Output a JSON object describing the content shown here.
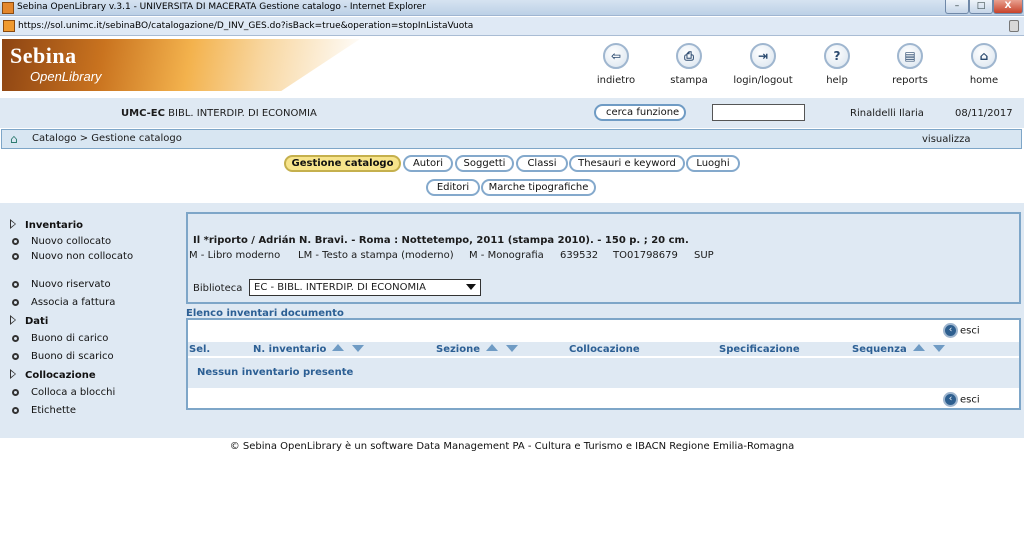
{
  "window": {
    "title": "Sebina OpenLibrary v.3.1 - UNIVERSITA DI MACERATA Gestione catalogo - Internet Explorer",
    "url": "https://sol.unimc.it/sebinaBO/catalogazione/D_INV_GES.do?isBack=true&operation=stopInListaVuota",
    "controls": {
      "minimize": "–",
      "maximize": "□",
      "close": "X"
    }
  },
  "logo": {
    "line1": "Sebina",
    "line2": "OpenLibrary"
  },
  "toolbar": [
    {
      "label": "indietro",
      "icon": "back-arrow-icon",
      "glyph": "⇦"
    },
    {
      "label": "stampa",
      "icon": "printer-icon",
      "glyph": "⎙"
    },
    {
      "label": "login/logout",
      "icon": "door-icon",
      "glyph": "⇥"
    },
    {
      "label": "help",
      "icon": "question-icon",
      "glyph": "?"
    },
    {
      "label": "reports",
      "icon": "documents-icon",
      "glyph": "▤"
    },
    {
      "label": "home",
      "icon": "home-icon",
      "glyph": "⌂"
    }
  ],
  "info": {
    "library_code": "UMC-EC",
    "library_name": "BIBL. INTERDIP. DI ECONOMIA",
    "cerca_label": "cerca funzione",
    "cerca_value": "",
    "user": "Rinaldelli Ilaria",
    "date": "08/11/2017"
  },
  "breadcrumb": {
    "path": "Catalogo > Gestione catalogo",
    "view_label": "visualizza"
  },
  "tabs": {
    "row1": [
      {
        "label": "Gestione catalogo",
        "active": true
      },
      {
        "label": "Autori",
        "active": false
      },
      {
        "label": "Soggetti",
        "active": false
      },
      {
        "label": "Classi",
        "active": false
      },
      {
        "label": "Thesauri e keyword",
        "active": false
      },
      {
        "label": "Luoghi",
        "active": false
      }
    ],
    "row2": [
      {
        "label": "Editori",
        "active": false
      },
      {
        "label": "Marche tipografiche",
        "active": false
      }
    ]
  },
  "sidebar": {
    "groups": [
      {
        "label": "Inventario",
        "items": [
          "Nuovo collocato",
          "Nuovo non collocato",
          "Nuovo riservato",
          "Associa a fattura"
        ]
      },
      {
        "label": "Dati",
        "items": [
          "Buono di carico",
          "Buono di scarico"
        ]
      },
      {
        "label": "Collocazione",
        "items": [
          "Colloca a blocchi",
          "Etichette"
        ]
      }
    ]
  },
  "record": {
    "title": "Il *riporto / Adrián N. Bravi. - Roma : Nottetempo, 2011 (stampa 2010). - 150 p. ; 20 cm.",
    "type": "M - Libro moderno",
    "material": "LM - Testo a stampa (moderno)",
    "level": "M - Monografia",
    "bid_number": "639532",
    "code": "TO01798679",
    "status": "SUP",
    "biblioteca_label": "Biblioteca",
    "biblioteca_value": "EC - BIBL. INTERDIP. DI ECONOMIA"
  },
  "inventory": {
    "title": "Elenco inventari documento",
    "esci_label": "esci",
    "columns": [
      "Sel.",
      "N. inventario",
      "Sezione",
      "Collocazione",
      "Specificazione",
      "Sequenza"
    ],
    "sortable": [
      false,
      true,
      true,
      false,
      false,
      true
    ],
    "empty_message": "Nessun inventario presente"
  },
  "footer": "© Sebina OpenLibrary è un software  Data Management PA - Cultura e Turismo e  IBACN Regione Emilia-Romagna"
}
